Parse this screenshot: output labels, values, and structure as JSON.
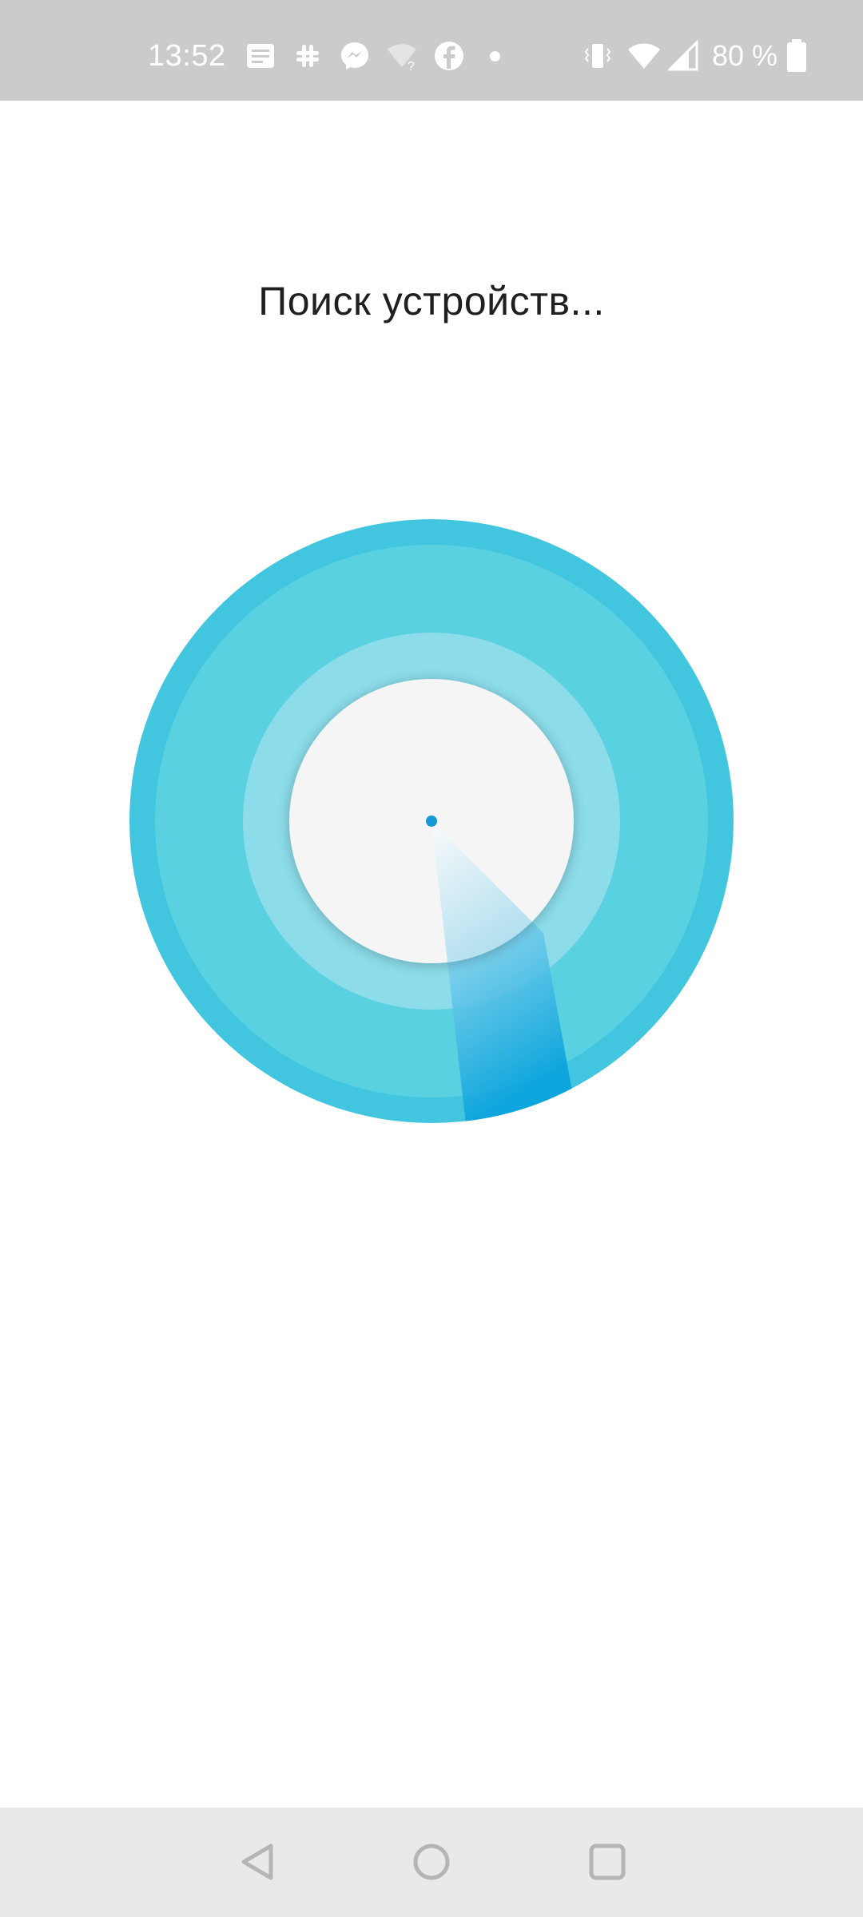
{
  "status_bar": {
    "time": "13:52",
    "battery_text": "80 %",
    "notification_icons": [
      "message-icon",
      "slack-icon",
      "messenger-icon",
      "wifi-question-icon",
      "facebook-icon",
      "more-dot-icon"
    ],
    "system_icons": [
      "vibrate-icon",
      "wifi-icon",
      "signal-icon",
      "battery-icon"
    ]
  },
  "main": {
    "title": "Поиск устройств..."
  },
  "radar": {
    "outer_color": "#45c8e0",
    "middle_color": "#5fd2e3",
    "inner_ring_color": "#8bdcea",
    "center_color": "#f5f5f5",
    "sweep_color": "#0aa3dc",
    "dot_color": "#1597d8"
  },
  "nav_bar": {
    "buttons": [
      "back-icon",
      "home-icon",
      "recents-icon"
    ]
  }
}
